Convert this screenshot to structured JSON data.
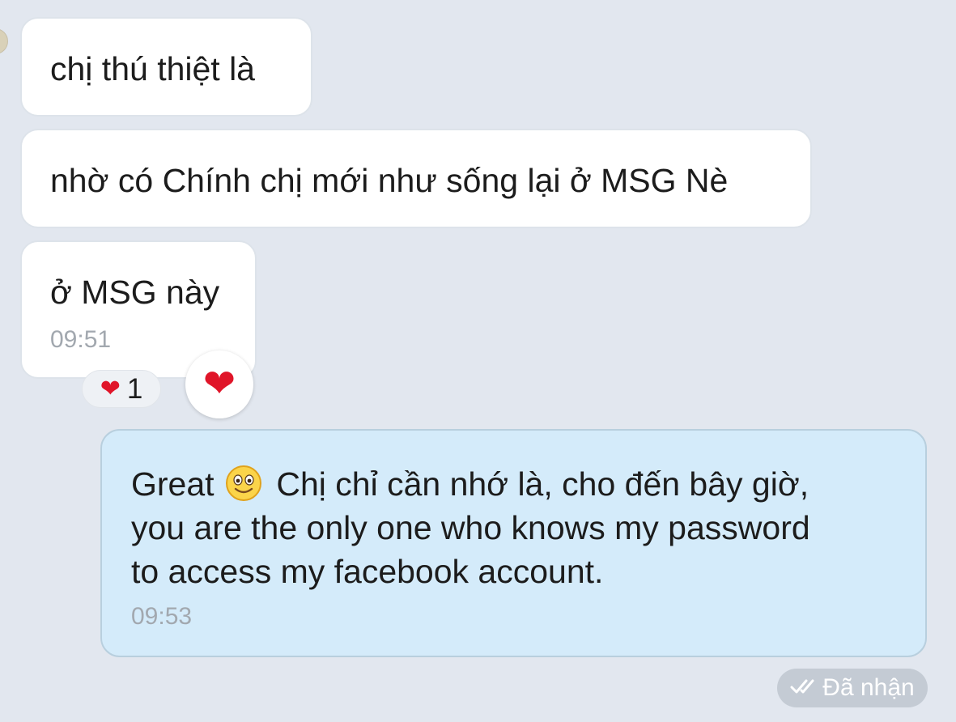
{
  "messages": {
    "incoming": [
      {
        "text": "chị thú thiệt là"
      },
      {
        "text": "nhờ có Chính chị mới như sống lại ở MSG Nè"
      },
      {
        "text": "ở MSG này",
        "time": "09:51"
      }
    ],
    "reaction": {
      "icon": "heart-icon",
      "count": "1",
      "color": "#e01529"
    },
    "outgoing": {
      "line1_before": "Great",
      "emoji": "smiling-face-icon",
      "line1_after": "Chị chỉ cần nhớ là, cho đến bây giờ,",
      "line2": "you are the only one who knows my password",
      "line3": "to access my facebook account.",
      "time": "09:53"
    },
    "status": {
      "icon": "double-check-icon",
      "label": "Đã nhận"
    }
  },
  "colors": {
    "background": "#e2e7ef",
    "incoming_bubble": "#ffffff",
    "outgoing_bubble": "#d4ebfa",
    "timestamp": "#a2a8af",
    "status_pill": "#c4cbd4"
  }
}
